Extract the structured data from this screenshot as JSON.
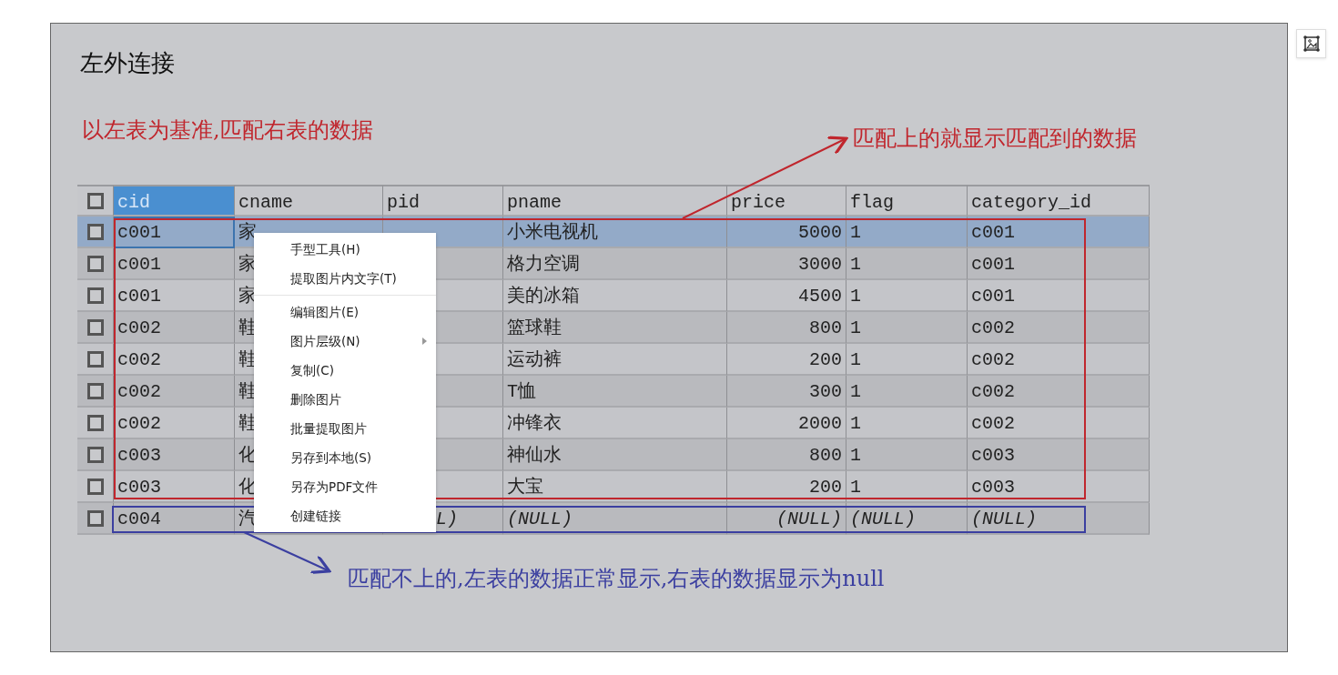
{
  "slide": {
    "title": "左外连接",
    "subtitle": "以左表为基准,匹配右表的数据",
    "note_matched": "匹配上的就显示匹配到的数据",
    "note_unmatched": "匹配不上的,左表的数据正常显示,右表的数据显示为null"
  },
  "table": {
    "header_checked": false,
    "columns": [
      {
        "label": "cid",
        "selected": true,
        "numeric": false
      },
      {
        "label": "cname",
        "selected": false,
        "numeric": false
      },
      {
        "label": "pid",
        "selected": false,
        "numeric": false
      },
      {
        "label": "pname",
        "selected": false,
        "numeric": false
      },
      {
        "label": "price",
        "selected": false,
        "numeric": true
      },
      {
        "label": "flag",
        "selected": false,
        "numeric": false
      },
      {
        "label": "category_id",
        "selected": false,
        "numeric": false
      }
    ],
    "rows": [
      {
        "checked": false,
        "selected": true,
        "kind": "matched",
        "cells": [
          "c001",
          "家",
          "",
          "小米电视机",
          "5000",
          "1",
          "c001"
        ]
      },
      {
        "checked": false,
        "selected": false,
        "kind": "matched",
        "cells": [
          "c001",
          "家",
          "",
          "格力空调",
          "3000",
          "1",
          "c001"
        ]
      },
      {
        "checked": false,
        "selected": false,
        "kind": "matched",
        "cells": [
          "c001",
          "家",
          "",
          "美的冰箱",
          "4500",
          "1",
          "c001"
        ]
      },
      {
        "checked": false,
        "selected": false,
        "kind": "matched",
        "cells": [
          "c002",
          "鞋",
          "",
          "篮球鞋",
          "800",
          "1",
          "c002"
        ]
      },
      {
        "checked": false,
        "selected": false,
        "kind": "matched",
        "cells": [
          "c002",
          "鞋",
          "",
          "运动裤",
          "200",
          "1",
          "c002"
        ]
      },
      {
        "checked": false,
        "selected": false,
        "kind": "matched",
        "cells": [
          "c002",
          "鞋",
          "",
          "T恤",
          "300",
          "1",
          "c002"
        ]
      },
      {
        "checked": false,
        "selected": false,
        "kind": "matched",
        "cells": [
          "c002",
          "鞋",
          "",
          "冲锋衣",
          "2000",
          "1",
          "c002"
        ]
      },
      {
        "checked": false,
        "selected": false,
        "kind": "matched",
        "cells": [
          "c003",
          "化",
          "",
          "神仙水",
          "800",
          "1",
          "c003"
        ]
      },
      {
        "checked": false,
        "selected": false,
        "kind": "matched",
        "cells": [
          "c003",
          "化",
          "",
          "大宝",
          "200",
          "1",
          "c003"
        ]
      },
      {
        "checked": false,
        "selected": false,
        "kind": "unmatched",
        "cells": [
          "c004",
          "汽",
          "L)",
          "(NULL)",
          "(NULL)",
          "(NULL)",
          "(NULL)"
        ]
      }
    ]
  },
  "context_menu": [
    {
      "label": "手型工具(H)",
      "separator_after": false,
      "submenu": false
    },
    {
      "label": "提取图片内文字(T)",
      "separator_after": true,
      "submenu": false
    },
    {
      "label": "编辑图片(E)",
      "separator_after": false,
      "submenu": false
    },
    {
      "label": "图片层级(N)",
      "separator_after": false,
      "submenu": true
    },
    {
      "label": "复制(C)",
      "separator_after": false,
      "submenu": false
    },
    {
      "label": "删除图片",
      "separator_after": false,
      "submenu": false
    },
    {
      "label": "批量提取图片",
      "separator_after": false,
      "submenu": false
    },
    {
      "label": "另存到本地(S)",
      "separator_after": false,
      "submenu": false
    },
    {
      "label": "另存为PDF文件",
      "separator_after": false,
      "submenu": false
    },
    {
      "label": "创建链接",
      "separator_after": false,
      "submenu": false
    }
  ]
}
